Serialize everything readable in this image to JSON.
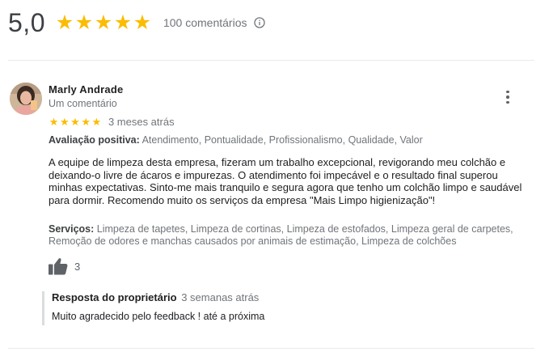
{
  "summary": {
    "score": "5,0",
    "stars": 5,
    "review_count": "100 comentários",
    "info_icon": "info-icon"
  },
  "review": {
    "reviewer_name": "Marly Andrade",
    "reviewer_sub": "Um comentário",
    "rating": 5,
    "date": "3 meses atrás",
    "positive_label": "Avaliação positiva:",
    "positive_values": "Atendimento, Pontualidade, Profissionalismo, Qualidade, Valor",
    "text": "A equipe de limpeza desta empresa, fizeram um trabalho excepcional, revigorando meu colchão e deixando-o livre de ácaros e impurezas. O atendimento foi impecável e o resultado final superou minhas expectativas. Sinto-me mais tranquilo e segura agora que tenho um colchão limpo e saudável para dormir. Recomendo muito os serviços da empresa \"Mais Limpo higienização\"!",
    "services_label": "Serviços:",
    "services_values": "Limpeza de tapetes, Limpeza de cortinas, Limpeza de estofados, Limpeza geral de carpetes, Remoção de odores e manchas causados por animais de estimação, Limpeza de colchões",
    "like_count": "3",
    "owner_reply": {
      "title": "Resposta do proprietário",
      "date": "3 semanas atrás",
      "text": "Muito agradecido pelo feedback ! até a próxima"
    }
  },
  "colors": {
    "star": "#fbbc04",
    "muted_text": "#70757a",
    "divider": "#e8eaed"
  }
}
